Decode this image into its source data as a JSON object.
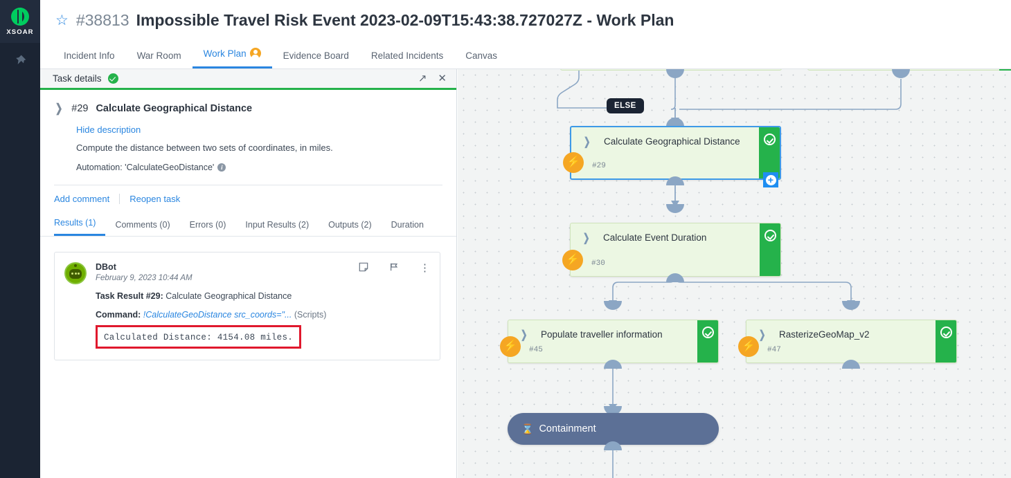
{
  "rail": {
    "logo_text": "XSOAR",
    "pin_icon": "pin-icon"
  },
  "header": {
    "star_icon": "star-icon",
    "incident_id": "#38813",
    "title": "Impossible Travel Risk Event 2023-02-09T15:43:38.727027Z - Work Plan"
  },
  "tabs": [
    {
      "label": "Incident Info",
      "active": false
    },
    {
      "label": "War Room",
      "active": false
    },
    {
      "label": "Work Plan",
      "active": true,
      "badge": "user-avatar"
    },
    {
      "label": "Evidence Board",
      "active": false
    },
    {
      "label": "Related Incidents",
      "active": false
    },
    {
      "label": "Canvas",
      "active": false
    }
  ],
  "panel": {
    "header_title": "Task details",
    "status": "completed",
    "expand_icon": "expand-icon",
    "close_icon": "close-icon",
    "task": {
      "number": "#29",
      "name": "Calculate Geographical Distance",
      "toggle_description_label": "Hide description",
      "description": "Compute the distance between two sets of coordinates, in miles.",
      "automation": "Automation: 'CalculateGeoDistance'"
    },
    "actions": {
      "add_comment": "Add comment",
      "reopen_task": "Reopen task"
    },
    "subtabs": [
      {
        "label": "Results (1)",
        "active": true
      },
      {
        "label": "Comments (0)",
        "active": false
      },
      {
        "label": "Errors (0)",
        "active": false
      },
      {
        "label": "Input Results (2)",
        "active": false
      },
      {
        "label": "Outputs (2)",
        "active": false
      },
      {
        "label": "Duration",
        "active": false
      }
    ],
    "result": {
      "author": "DBot",
      "timestamp": "February 9, 2023 10:44 AM",
      "task_result_label": "Task Result",
      "task_result_id": "#29:",
      "task_result_name": "Calculate Geographical Distance",
      "command_label": "Command:",
      "command_value": "!CalculateGeoDistance src_coords=\"...",
      "command_source": "(Scripts)",
      "output_text": "Calculated Distance: 4154.08 miles.",
      "highlight_color": "#e0182d",
      "icons": {
        "note": "note-icon",
        "flag": "flag-icon",
        "more": "more-vertical-icon"
      }
    }
  },
  "canvas": {
    "else_chip": "ELSE",
    "add_task_badge": "add-task-plus",
    "nodes": [
      {
        "label": "Calculate Geographical Distance",
        "id": "#29",
        "status": "completed",
        "selected": true
      },
      {
        "label": "Calculate Event Duration",
        "id": "#30",
        "status": "completed",
        "selected": false
      },
      {
        "label": "Populate traveller information",
        "id": "#45",
        "status": "completed",
        "selected": false
      },
      {
        "label": "RasterizeGeoMap_v2",
        "id": "#47",
        "status": "completed",
        "selected": false
      }
    ],
    "section": {
      "label": "Containment",
      "icon": "hourglass-icon"
    }
  },
  "colors": {
    "accent_blue": "#2a86e0",
    "success_green": "#25b24b",
    "node_fill": "#ecf7e3",
    "warning_orange": "#f5a623",
    "danger_red": "#e0182d",
    "section_slate": "#5c7096",
    "rail_dark": "#1b2433"
  }
}
